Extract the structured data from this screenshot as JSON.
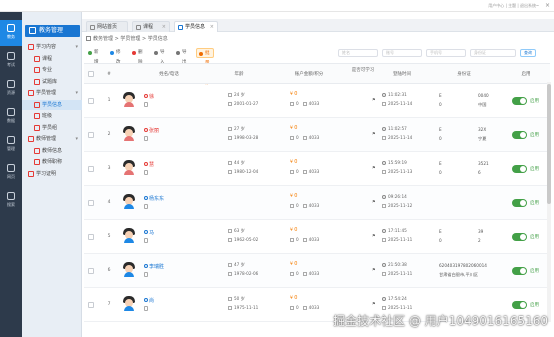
{
  "window": {
    "top_right_text": "用户中心 | 主题 | 退出系统"
  },
  "rail": [
    {
      "label": "教务",
      "icon": "school-icon"
    },
    {
      "label": "考试",
      "icon": "exam-icon"
    },
    {
      "label": "资源",
      "icon": "resource-icon"
    },
    {
      "label": "数据",
      "icon": "data-icon"
    },
    {
      "label": "管理",
      "icon": "manage-icon"
    },
    {
      "label": "网页",
      "icon": "web-icon"
    },
    {
      "label": "搜索",
      "icon": "search-icon"
    }
  ],
  "sidebar": {
    "title": "教务管理",
    "items": [
      {
        "label": "学习内容",
        "level": 1,
        "arrow": "▾"
      },
      {
        "label": "课程",
        "level": 2
      },
      {
        "label": "专业",
        "level": 2
      },
      {
        "label": "试题库",
        "level": 2
      },
      {
        "label": "学员管理",
        "level": 1,
        "arrow": "▾"
      },
      {
        "label": "学员信息",
        "level": 2,
        "active": true
      },
      {
        "label": "班级",
        "level": 2
      },
      {
        "label": "学员组",
        "level": 2
      },
      {
        "label": "教师管理",
        "level": 1,
        "arrow": "▾"
      },
      {
        "label": "教师信息",
        "level": 2
      },
      {
        "label": "教师职称",
        "level": 2
      },
      {
        "label": "学习证明",
        "level": 1
      }
    ]
  },
  "tabs": [
    {
      "label": "网站首页",
      "active": false
    },
    {
      "label": "课程",
      "active": false
    },
    {
      "label": "学员信息",
      "active": true
    }
  ],
  "breadcrumb": "教务管理 > 学员管理 > 学员信息",
  "search": {
    "fields": [
      "姓名",
      "账号",
      "手机号",
      "身份证"
    ],
    "button": "查询"
  },
  "toolbar": [
    {
      "label": "新增",
      "color": "#43a047"
    },
    {
      "label": "修改",
      "color": "#1e88e5"
    },
    {
      "label": "删除",
      "color": "#e53935"
    },
    {
      "label": "导入",
      "color": "#757575"
    },
    {
      "label": "导出",
      "color": "#757575"
    },
    {
      "label": "批量操作",
      "color": "#ef6c00"
    }
  ],
  "table": {
    "columns": [
      "#",
      "姓名/电话",
      "年龄",
      "账户金额/积分",
      "是否可学习",
      "登陆时间",
      "身份证",
      "启用"
    ],
    "rows": [
      {
        "index": "1",
        "name": "徐",
        "gender": "f",
        "age": "24 岁",
        "birth": "2001-01-27",
        "money": "0",
        "points": "0",
        "coupons": "4033",
        "time": "11:02:31",
        "date": "2025-11-14",
        "id_a": "E",
        "id_b": "0040",
        "id_c": "0",
        "id_d": "中国",
        "enabled": "启用"
      },
      {
        "index": "2",
        "name": "张丽",
        "gender": "f",
        "age": "27 岁",
        "birth": "1998-03-28",
        "money": "0",
        "points": "0",
        "coupons": "4033",
        "time": "11:02:57",
        "date": "2025-11-14",
        "id_a": "E",
        "id_b": "32X",
        "id_c": "0",
        "id_d": "宁夏",
        "enabled": "启用"
      },
      {
        "index": "3",
        "name": "慧",
        "gender": "f",
        "age": "44 岁",
        "birth": "1980-12-04",
        "money": "0",
        "points": "0",
        "coupons": "4033",
        "time": "15:59:19",
        "date": "2025-11-13",
        "id_a": "E",
        "id_b": "3521",
        "id_c": "0",
        "id_d": "6",
        "enabled": "启用"
      },
      {
        "index": "4",
        "name": "杨东东",
        "gender": "m",
        "age": "",
        "birth": "",
        "money": "0",
        "points": "0",
        "coupons": "4033",
        "time": "09:26:14",
        "date": "2025-11-12",
        "id_a": "",
        "id_b": "",
        "id_c": "",
        "id_d": "",
        "enabled": "启用"
      },
      {
        "index": "5",
        "name": "马",
        "gender": "m",
        "age": "63 岁",
        "birth": "1962-05-02",
        "money": "0",
        "points": "0",
        "coupons": "4033",
        "time": "17:11:45",
        "date": "2025-11-11",
        "id_a": "E",
        "id_b": "39",
        "id_c": "0",
        "id_d": "2",
        "enabled": "启用"
      },
      {
        "index": "6",
        "name": "李瑞胜",
        "gender": "m",
        "age": "47 岁",
        "birth": "1978-02-06",
        "money": "0",
        "points": "0",
        "coupons": "4033",
        "time": "21:50:38",
        "date": "2025-11-11",
        "id_a": "620403197802060014",
        "id_b": "",
        "id_c": "甘肃省白银市,平川区",
        "id_d": "",
        "enabled": "启用"
      },
      {
        "index": "7",
        "name": "尚",
        "gender": "m",
        "age": "50 岁",
        "birth": "1975-11-11",
        "money": "0",
        "points": "0",
        "coupons": "4033",
        "time": "17:54:24",
        "date": "2025-11-11",
        "id_a": "",
        "id_b": "",
        "id_c": "",
        "id_d": "",
        "enabled": "启用"
      }
    ]
  },
  "watermark": "掘金技术社区 @ 用户1049016165160",
  "colors": {
    "primary": "#1976d2",
    "success": "#43a047",
    "warning": "#ef6c00",
    "danger": "#e53935"
  }
}
